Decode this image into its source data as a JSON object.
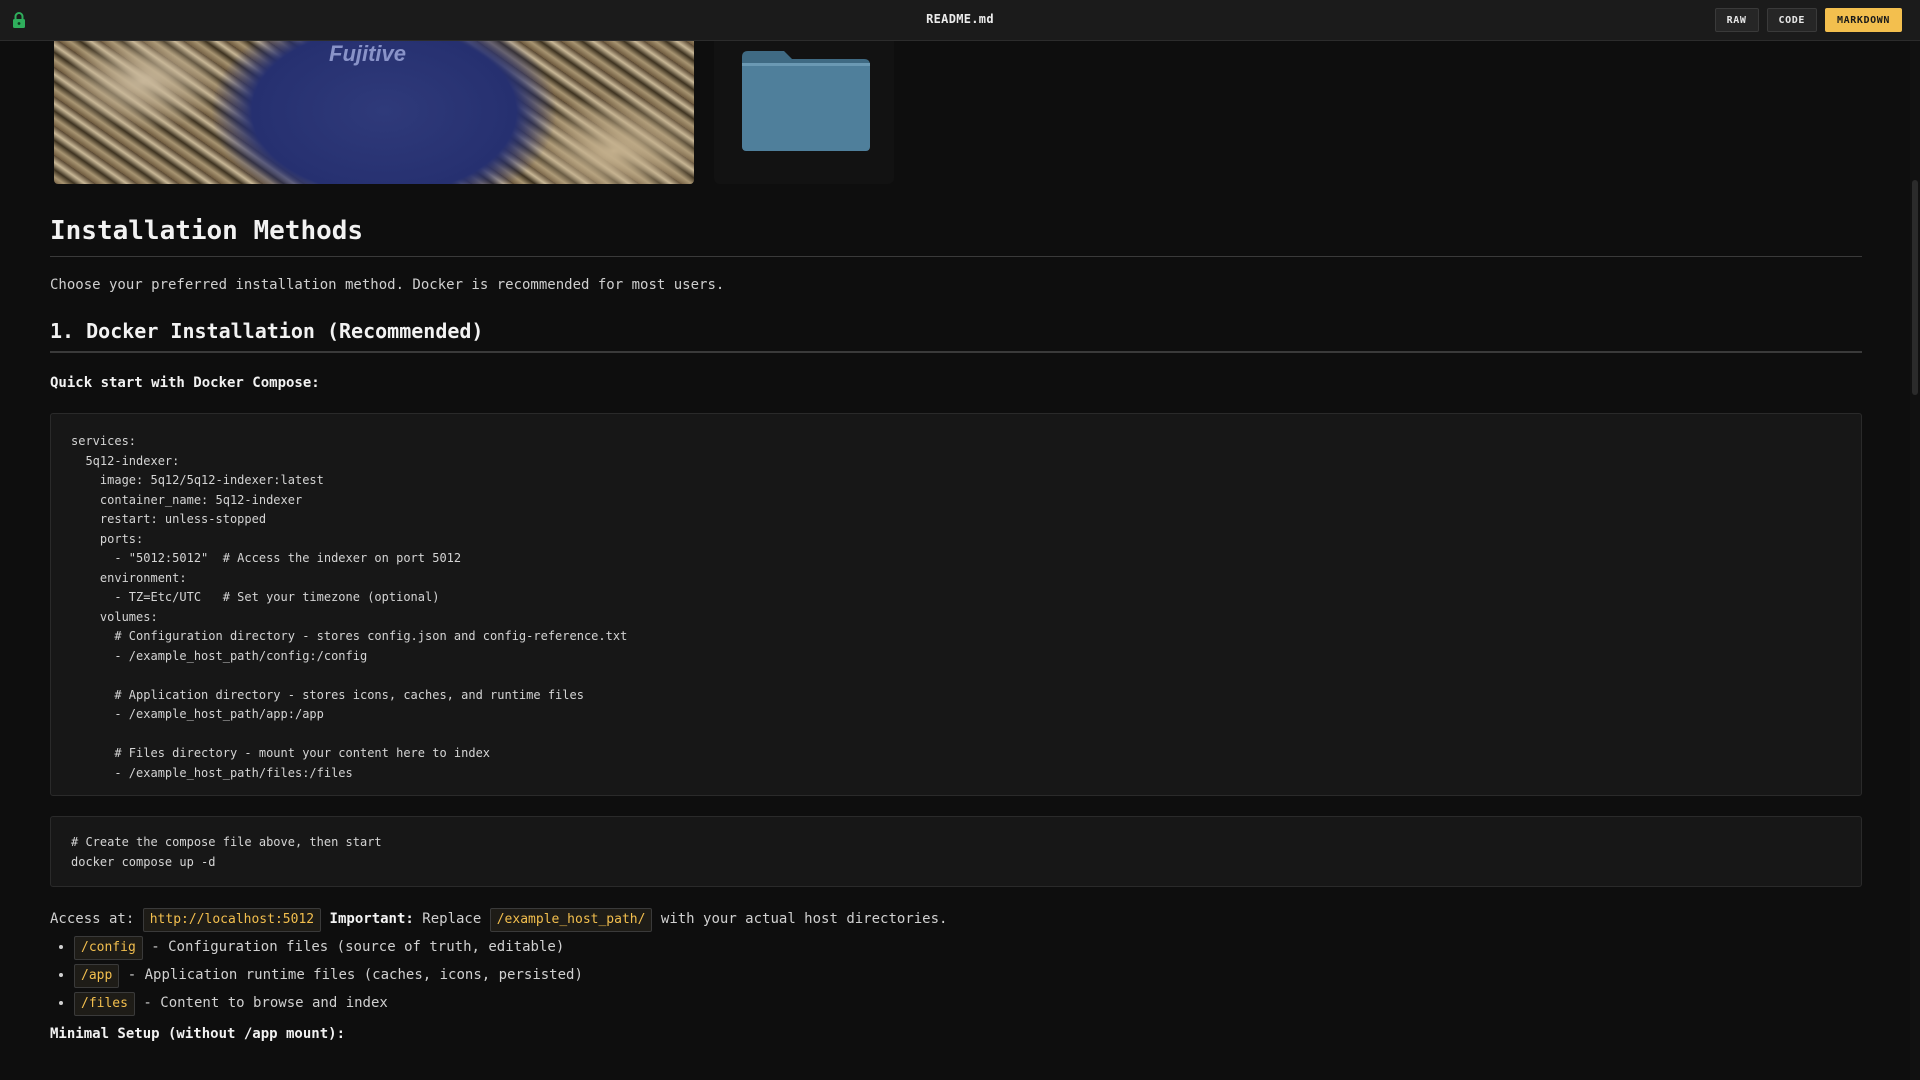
{
  "window": {
    "title": "README.md",
    "lock_icon": "lock-icon",
    "buttons": {
      "raw": "RAW",
      "code": "CODE",
      "markdown": "MARKDOWN"
    },
    "active_view": "MARKDOWN",
    "accent_color": "#f3bf4e"
  },
  "images": {
    "poster_text": "Fujitive",
    "folder_icon": "folder-icon"
  },
  "doc": {
    "heading": "Installation Methods",
    "intro": "Choose your preferred installation method. Docker is recommended for most users.",
    "docker_heading": "1. Docker Installation (Recommended)",
    "quick_start": "Quick start with Docker Compose:",
    "compose_yaml": "services:\n  5q12-indexer:\n    image: 5q12/5q12-indexer:latest\n    container_name: 5q12-indexer\n    restart: unless-stopped\n    ports:\n      - \"5012:5012\"  # Access the indexer on port 5012\n    environment:\n      - TZ=Etc/UTC   # Set your timezone (optional)\n    volumes:\n      # Configuration directory - stores config.json and config-reference.txt\n      - /example_host_path/config:/config\n\n      # Application directory - stores icons, caches, and runtime files\n      - /example_host_path/app:/app\n\n      # Files directory - mount your content here to index\n      - /example_host_path/files:/files",
    "compose_cmd": "# Create the compose file above, then start\ndocker compose up -d",
    "access_label": "Access at:",
    "access_url": "http://localhost:5012",
    "important_label": "Important:",
    "replace_text": "Replace",
    "host_path": "/example_host_path/",
    "replace_suffix": "with your actual host directories.",
    "paths": [
      {
        "code": "/config",
        "desc": "- Configuration files (source of truth, editable)"
      },
      {
        "code": "/app",
        "desc": "- Application runtime files (caches, icons, persisted)"
      },
      {
        "code": "/files",
        "desc": "- Content to browse and index"
      }
    ],
    "minimal_setup": "Minimal Setup (without /app mount):"
  }
}
